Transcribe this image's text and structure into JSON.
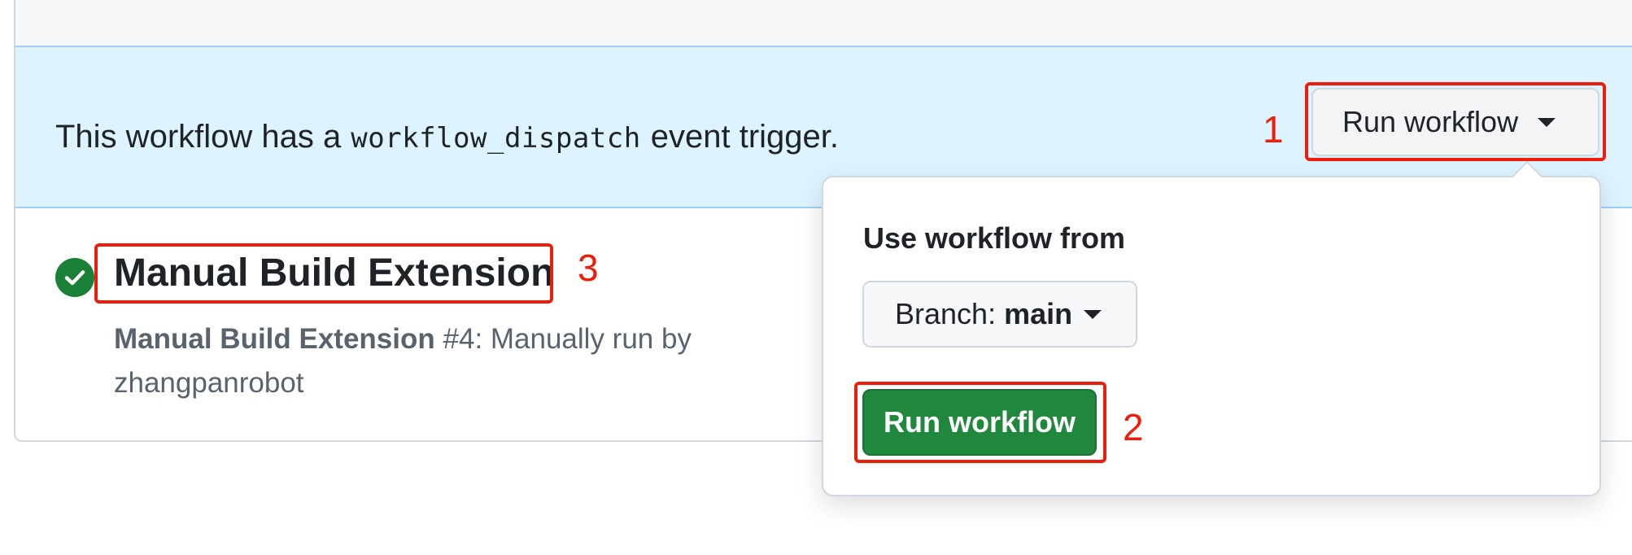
{
  "banner": {
    "text_before": "This workflow has a",
    "code": "workflow_dispatch",
    "text_after": "event trigger."
  },
  "run_workflow_button": {
    "label": "Run workflow",
    "icon": "triangle-down-icon"
  },
  "popover": {
    "heading": "Use workflow from",
    "branch_label": "Branch:",
    "branch_value": "main",
    "run_button_label": "Run workflow"
  },
  "workflow": {
    "title": "Manual Build Extension",
    "status_icon": "check-circle-fill-icon",
    "run_name": "Manual Build Extension",
    "run_number": "#4",
    "run_text": ": Manually run by",
    "actor": "zhangpanrobot"
  },
  "annotations": {
    "one": "1",
    "two": "2",
    "three": "3"
  },
  "colors": {
    "banner_bg": "#ddf4ff",
    "success_green": "#1a7f37",
    "primary_button": "#1f883d",
    "annotation_red": "#ee1c0a"
  }
}
